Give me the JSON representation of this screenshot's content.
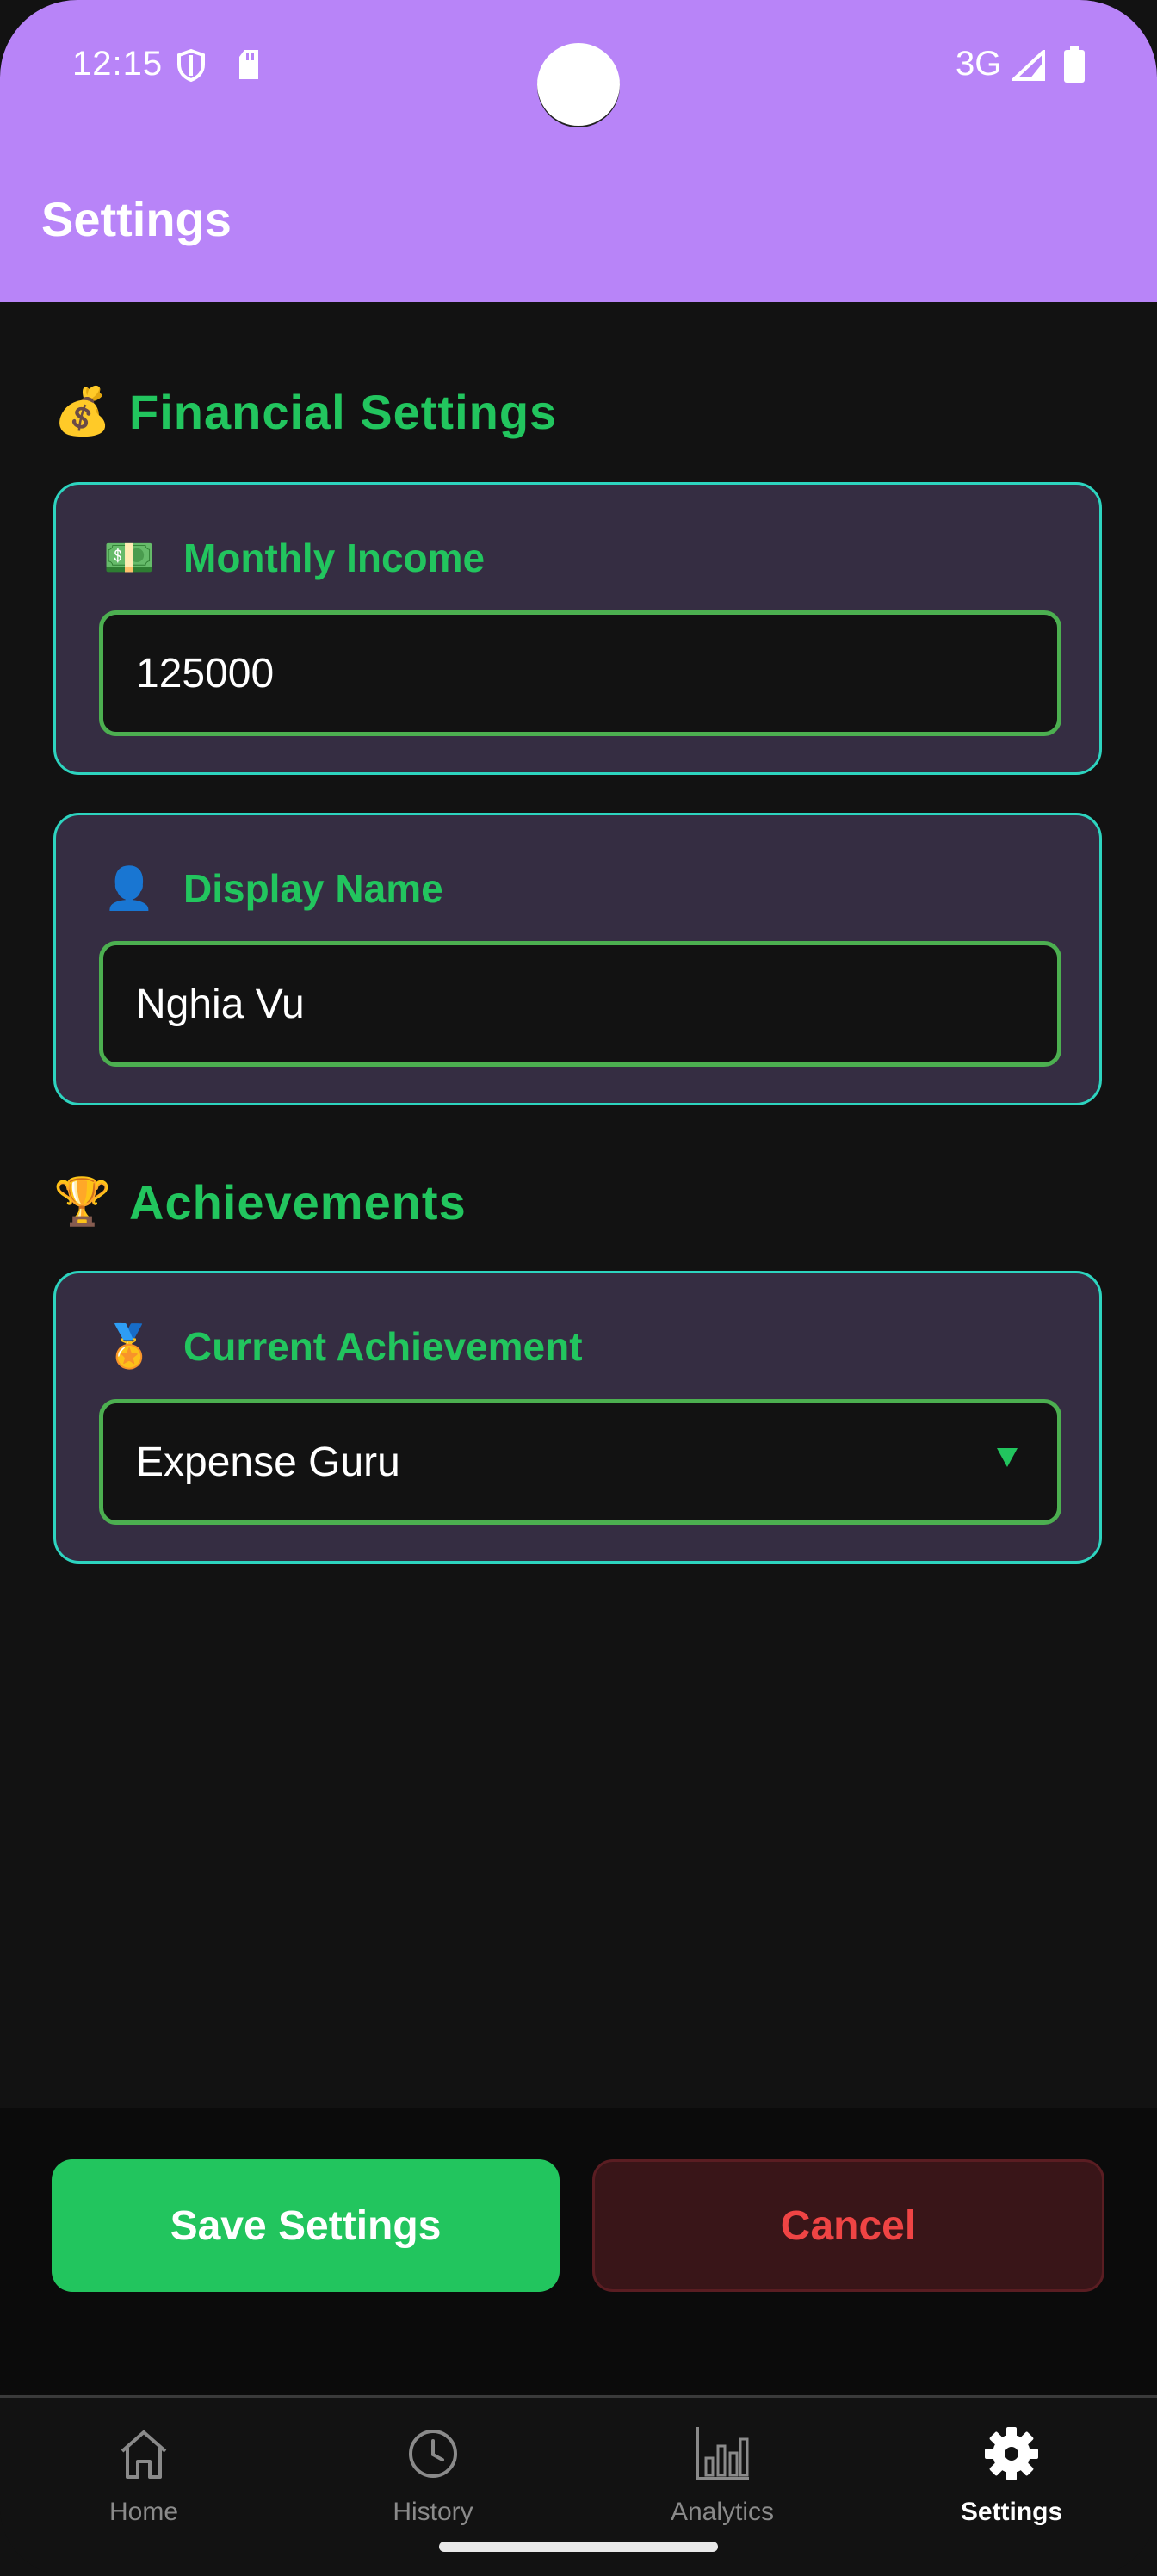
{
  "status_bar": {
    "time": "12:15",
    "network": "3G",
    "icons": [
      "shield-icon",
      "sd-card-icon",
      "signal-icon",
      "battery-icon"
    ]
  },
  "app_bar": {
    "title": "Settings"
  },
  "sections": {
    "financial": {
      "emoji": "💰",
      "title": "Financial Settings",
      "monthly_income": {
        "emoji": "💵",
        "label": "Monthly Income",
        "value": "125000"
      },
      "display_name": {
        "emoji": "👤",
        "label": "Display Name",
        "value": "Nghia Vu"
      }
    },
    "achievements": {
      "emoji": "🏆",
      "title": "Achievements",
      "current": {
        "emoji": "🏅",
        "label": "Current Achievement",
        "value": "Expense Guru"
      }
    }
  },
  "actions": {
    "save_label": "Save Settings",
    "cancel_label": "Cancel"
  },
  "nav": {
    "items": [
      {
        "label": "Home",
        "icon": "home-icon",
        "active": false
      },
      {
        "label": "History",
        "icon": "clock-icon",
        "active": false
      },
      {
        "label": "Analytics",
        "icon": "bar-chart-icon",
        "active": false
      },
      {
        "label": "Settings",
        "icon": "gear-icon",
        "active": true
      }
    ]
  },
  "colors": {
    "app_bar": "#B884F8",
    "accent_green": "#22C55E",
    "card_border": "#2DD4BF",
    "card_bg": "#352D42",
    "cancel_text": "#EF4444"
  }
}
